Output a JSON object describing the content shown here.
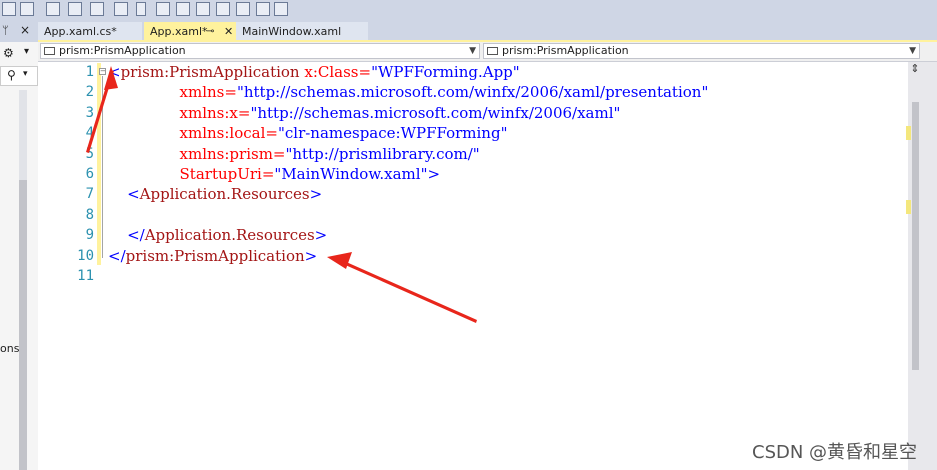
{
  "tabs": [
    {
      "label": "App.xaml.cs*",
      "active": false
    },
    {
      "label": "App.xaml*",
      "active": true,
      "pin_icon": "pin-icon",
      "close_icon": "close-icon"
    },
    {
      "label": "MainWindow.xaml",
      "active": false
    }
  ],
  "left_panel": {
    "partial_text": "ons",
    "pin_glyph": "⮟"
  },
  "navbar": {
    "left_combo": "prism:PrismApplication",
    "right_combo": "prism:PrismApplication"
  },
  "editor": {
    "line_numbers": [
      "1",
      "2",
      "3",
      "4",
      "5",
      "6",
      "7",
      "8",
      "9",
      "10",
      "11"
    ],
    "lines": [
      {
        "prefix": "",
        "br_open": "<",
        "el": "prism:PrismApplication",
        "rest": [
          {
            "t": " x:Class=",
            "c": "at"
          },
          {
            "t": "\"WPFForming.App\"",
            "c": "vl"
          }
        ]
      },
      {
        "indent": "               ",
        "rest": [
          {
            "t": "xmlns=",
            "c": "at"
          },
          {
            "t": "\"http://schemas.microsoft.com/winfx/2006/xaml/presentation\"",
            "c": "vl"
          }
        ]
      },
      {
        "indent": "               ",
        "rest": [
          {
            "t": "xmlns:x=",
            "c": "at"
          },
          {
            "t": "\"http://schemas.microsoft.com/winfx/2006/xaml\"",
            "c": "vl"
          }
        ]
      },
      {
        "indent": "               ",
        "rest": [
          {
            "t": "xmlns:local=",
            "c": "at"
          },
          {
            "t": "\"clr-namespace:WPFForming\"",
            "c": "vl"
          }
        ]
      },
      {
        "indent": "               ",
        "rest": [
          {
            "t": "xmlns:prism=",
            "c": "at"
          },
          {
            "t": "\"http://prismlibrary.com/\"",
            "c": "vl"
          }
        ]
      },
      {
        "indent": "               ",
        "rest": [
          {
            "t": "StartupUri=",
            "c": "at"
          },
          {
            "t": "\"MainWindow.xaml\"",
            "c": "vl"
          },
          {
            "t": ">",
            "c": "br"
          }
        ]
      },
      {
        "indent": "    ",
        "rest": [
          {
            "t": "<",
            "c": "br"
          },
          {
            "t": "Application.Resources",
            "c": "el"
          },
          {
            "t": ">",
            "c": "br"
          }
        ]
      },
      {
        "indent": "",
        "rest": []
      },
      {
        "indent": "    ",
        "rest": [
          {
            "t": "</",
            "c": "br"
          },
          {
            "t": "Application.Resources",
            "c": "el"
          },
          {
            "t": ">",
            "c": "br"
          }
        ]
      },
      {
        "indent": "",
        "rest": [
          {
            "t": "</",
            "c": "br"
          },
          {
            "t": "prism:PrismApplication",
            "c": "el"
          },
          {
            "t": ">",
            "c": "br"
          }
        ]
      },
      {
        "indent": "",
        "rest": []
      }
    ]
  },
  "watermark": "CSDN @黄昏和星空",
  "colors": {
    "tab_active": "#fff29d",
    "line_number": "#2b91af",
    "xml_bracket": "#0000ff",
    "xml_element": "#a31515",
    "xml_attribute": "#ff0000",
    "xml_value": "#0000ff",
    "annotation_arrow": "#e8261b"
  },
  "icons": [
    "pin-icon",
    "close-icon",
    "search-icon",
    "combo-dropdown-icon",
    "split-editor-icon",
    "collapse-outline-icon"
  ]
}
